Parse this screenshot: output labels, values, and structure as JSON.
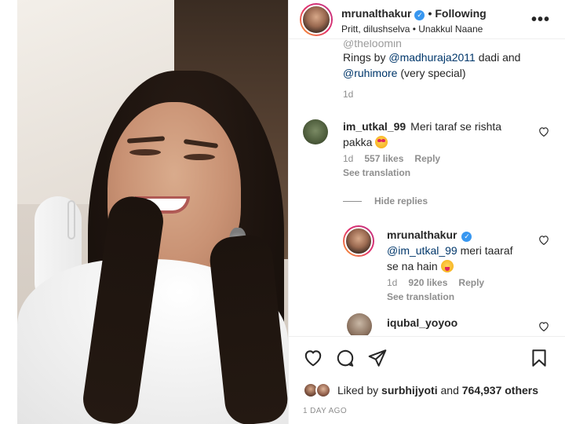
{
  "post_header": {
    "username": "mrunalthakur",
    "verified_icon": "verified-badge-icon",
    "separator": "•",
    "follow_status": "Following",
    "subline": "Pritt, dilushselva • Unakkul Naane",
    "more_icon": "more-options-icon"
  },
  "caption": {
    "faded_line": "@theloomin",
    "line1_prefix": "Rings by ",
    "line1_mention": "@madhuraja2011",
    "line1_suffix": " dadi and",
    "line2_mention": "@ruhimore",
    "line2_suffix": " (very special)",
    "time": "1d"
  },
  "comments": [
    {
      "username": "im_utkal_99",
      "text": "Meri taraf se rishta pakka",
      "emoji": "heart-eyes-emoji",
      "time": "1d",
      "likes": "557 likes",
      "reply_label": "Reply",
      "see_translation": "See translation"
    }
  ],
  "hide_replies_label": "Hide replies",
  "reply": {
    "username": "mrunalthakur",
    "mention": "@im_utkal_99",
    "text_line1_suffix": " meri taaraf",
    "text_line2": "se na hain",
    "emoji": "tongue-out-emoji",
    "time": "1d",
    "likes": "920 likes",
    "reply_label": "Reply",
    "see_translation": "See translation"
  },
  "partial_comment": {
    "username": "iqubal_yoyoo"
  },
  "actions": {
    "like_icon": "heart-icon",
    "comment_icon": "comment-icon",
    "share_icon": "share-icon",
    "save_icon": "bookmark-icon"
  },
  "likes": {
    "prefix": "Liked by ",
    "user": "surbhijyoti",
    "middle": " and ",
    "count": "764,937 others"
  },
  "timestamp": "1 DAY AGO",
  "colors": {
    "link": "#00376b",
    "muted": "#8e8e8e",
    "verified": "#3897f0",
    "text": "#262626"
  }
}
